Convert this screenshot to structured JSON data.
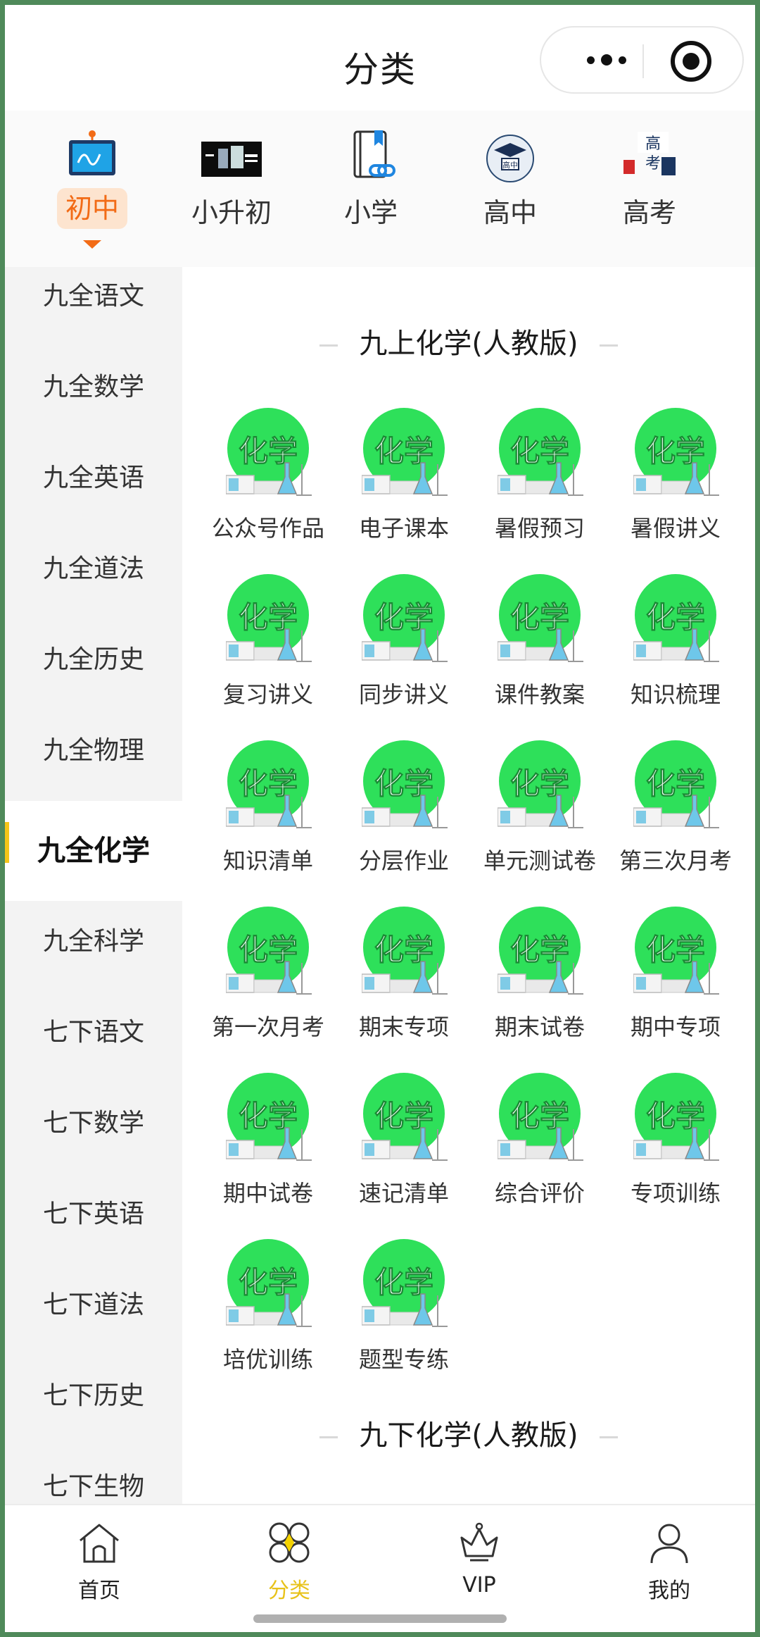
{
  "header": {
    "title": "分类"
  },
  "levels": [
    {
      "label": "初中",
      "active": true,
      "icon": "monitor-icon"
    },
    {
      "label": "小升初",
      "active": false,
      "icon": "banner-icon"
    },
    {
      "label": "小学",
      "active": false,
      "icon": "book-link-icon"
    },
    {
      "label": "高中",
      "active": false,
      "icon": "graduation-cap-icon"
    },
    {
      "label": "高考",
      "active": false,
      "icon": "gaokao-icon"
    }
  ],
  "sidebar": {
    "items": [
      {
        "label": "九全语文"
      },
      {
        "label": "九全数学"
      },
      {
        "label": "九全英语"
      },
      {
        "label": "九全道法"
      },
      {
        "label": "九全历史"
      },
      {
        "label": "九全物理"
      },
      {
        "label": "九全化学",
        "active": true
      },
      {
        "label": "九全科学"
      },
      {
        "label": "七下语文"
      },
      {
        "label": "七下数学"
      },
      {
        "label": "七下英语"
      },
      {
        "label": "七下道法"
      },
      {
        "label": "七下历史"
      },
      {
        "label": "七下生物"
      }
    ]
  },
  "content": {
    "sections": [
      {
        "title": "九上化学(人教版)",
        "icon_text": "化学",
        "items": [
          {
            "label": "公众号作品"
          },
          {
            "label": "电子课本"
          },
          {
            "label": "暑假预习"
          },
          {
            "label": "暑假讲义"
          },
          {
            "label": "复习讲义"
          },
          {
            "label": "同步讲义"
          },
          {
            "label": "课件教案"
          },
          {
            "label": "知识梳理"
          },
          {
            "label": "知识清单"
          },
          {
            "label": "分层作业"
          },
          {
            "label": "单元测试卷"
          },
          {
            "label": "第三次月考"
          },
          {
            "label": "第一次月考"
          },
          {
            "label": "期末专项"
          },
          {
            "label": "期末试卷"
          },
          {
            "label": "期中专项"
          },
          {
            "label": "期中试卷"
          },
          {
            "label": "速记清单"
          },
          {
            "label": "综合评价"
          },
          {
            "label": "专项训练"
          },
          {
            "label": "培优训练"
          },
          {
            "label": "题型专练"
          }
        ]
      },
      {
        "title": "九下化学(人教版)"
      }
    ]
  },
  "tabbar": {
    "items": [
      {
        "label": "首页",
        "icon": "home-icon"
      },
      {
        "label": "分类",
        "icon": "category-icon",
        "active": true
      },
      {
        "label": "VIP",
        "icon": "crown-icon"
      },
      {
        "label": "我的",
        "icon": "user-icon"
      }
    ]
  },
  "colors": {
    "accent_orange": "#f26b16",
    "accent_yellow": "#e8c21a",
    "chem_green": "#2ee05a",
    "sidebar_bg": "#f3f3f3"
  }
}
